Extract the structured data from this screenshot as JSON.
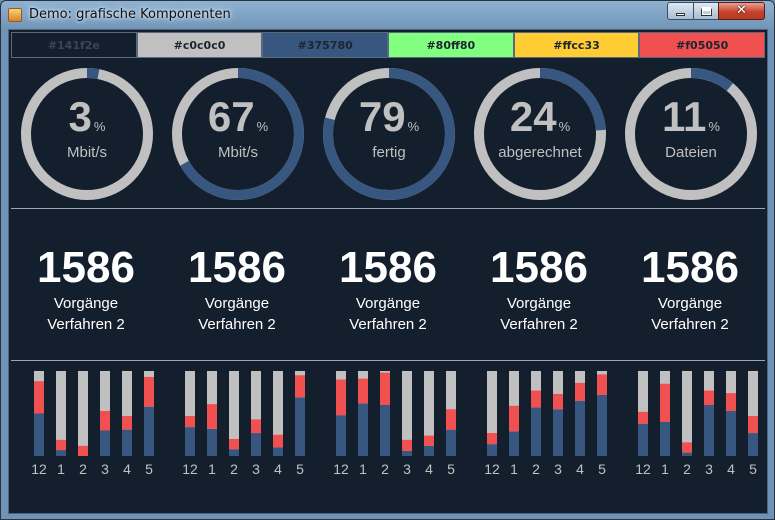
{
  "window": {
    "title": "Demo: grafische Komponenten"
  },
  "swatches": [
    "#141f2e",
    "#c0c0c0",
    "#375780",
    "#80ff80",
    "#ffcc33",
    "#f05050"
  ],
  "colors": {
    "track": "#c0c0c0",
    "fill": "#375780",
    "bar_blue": "#375780",
    "bar_red": "#f05050",
    "bar_gray": "#c0c0c0",
    "text": "#c0c0c0"
  },
  "gauges": [
    {
      "value": "3",
      "percent": 3,
      "unit": "Mbit/s",
      "pct_sign": "%"
    },
    {
      "value": "67",
      "percent": 67,
      "unit": "Mbit/s",
      "pct_sign": "%"
    },
    {
      "value": "79",
      "percent": 79,
      "unit": "fertig",
      "pct_sign": "%"
    },
    {
      "value": "24",
      "percent": 24,
      "unit": "abgerechnet",
      "pct_sign": "%"
    },
    {
      "value": "11",
      "percent": 11,
      "unit": "Dateien",
      "pct_sign": "%"
    }
  ],
  "counters": [
    {
      "number": "1586",
      "line1": "Vorgänge",
      "line2": "Verfahren 2"
    },
    {
      "number": "1586",
      "line1": "Vorgänge",
      "line2": "Verfahren 2"
    },
    {
      "number": "1586",
      "line1": "Vorgänge",
      "line2": "Verfahren 2"
    },
    {
      "number": "1586",
      "line1": "Vorgänge",
      "line2": "Verfahren 2"
    },
    {
      "number": "1586",
      "line1": "Vorgänge",
      "line2": "Verfahren 2"
    }
  ],
  "chart_data": [
    {
      "type": "bar",
      "categories": [
        "12",
        "1",
        "2",
        "3",
        "4",
        "5"
      ],
      "series": [
        {
          "name": "",
          "values": [
            50,
            7,
            0,
            30,
            31,
            58
          ]
        },
        {
          "name": "",
          "values": [
            38,
            12,
            12,
            23,
            16,
            35
          ]
        }
      ],
      "ylim": [
        0,
        100
      ]
    },
    {
      "type": "bar",
      "categories": [
        "12",
        "1",
        "2",
        "3",
        "4",
        "5"
      ],
      "series": [
        {
          "name": "",
          "values": [
            34,
            32,
            8,
            27,
            10,
            69
          ]
        },
        {
          "name": "",
          "values": [
            13,
            29,
            12,
            16,
            15,
            26
          ]
        }
      ],
      "ylim": [
        0,
        100
      ]
    },
    {
      "type": "bar",
      "categories": [
        "12",
        "1",
        "2",
        "3",
        "4",
        "5"
      ],
      "series": [
        {
          "name": "",
          "values": [
            48,
            62,
            60,
            6,
            12,
            31
          ]
        },
        {
          "name": "",
          "values": [
            42,
            29,
            38,
            13,
            12,
            24
          ]
        }
      ],
      "ylim": [
        0,
        100
      ]
    },
    {
      "type": "bar",
      "categories": [
        "12",
        "1",
        "2",
        "3",
        "4",
        "5"
      ],
      "series": [
        {
          "name": "",
          "values": [
            14,
            29,
            57,
            55,
            65,
            72
          ]
        },
        {
          "name": "",
          "values": [
            13,
            30,
            20,
            18,
            21,
            24
          ]
        }
      ],
      "ylim": [
        0,
        100
      ]
    },
    {
      "type": "bar",
      "categories": [
        "12",
        "1",
        "2",
        "3",
        "4",
        "5"
      ],
      "series": [
        {
          "name": "",
          "values": [
            38,
            40,
            4,
            60,
            53,
            27
          ]
        },
        {
          "name": "",
          "values": [
            14,
            45,
            12,
            17,
            21,
            20
          ]
        }
      ],
      "ylim": [
        0,
        100
      ]
    }
  ]
}
